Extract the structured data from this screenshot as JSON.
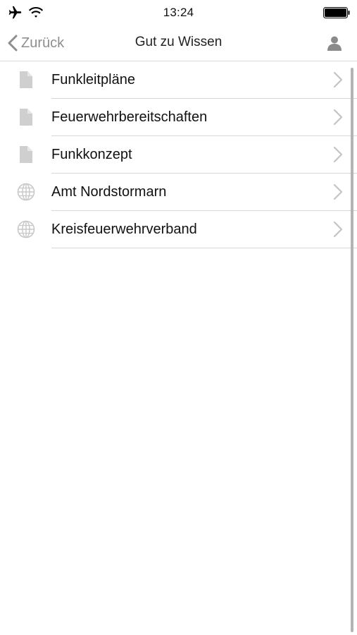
{
  "status_bar": {
    "time": "13:24",
    "icons": [
      "airplane-icon",
      "wifi-icon",
      "battery-icon"
    ]
  },
  "nav": {
    "back_label": "Zurück",
    "title": "Gut zu Wissen",
    "right_icon": "person-icon"
  },
  "list": {
    "items": [
      {
        "label": "Funkleitpläne",
        "icon": "document-icon"
      },
      {
        "label": "Feuerwehrbereitschaften",
        "icon": "document-icon"
      },
      {
        "label": "Funkkonzept",
        "icon": "document-icon"
      },
      {
        "label": "Amt Nordstormarn",
        "icon": "globe-icon"
      },
      {
        "label": "Kreisfeuerwehrverband",
        "icon": "globe-icon"
      }
    ]
  },
  "colors": {
    "text": "#111111",
    "muted": "#8e8e8e",
    "icon_gray": "#cfcfcf",
    "separator": "#d6d6d6",
    "chevron": "#c4c4c4"
  }
}
